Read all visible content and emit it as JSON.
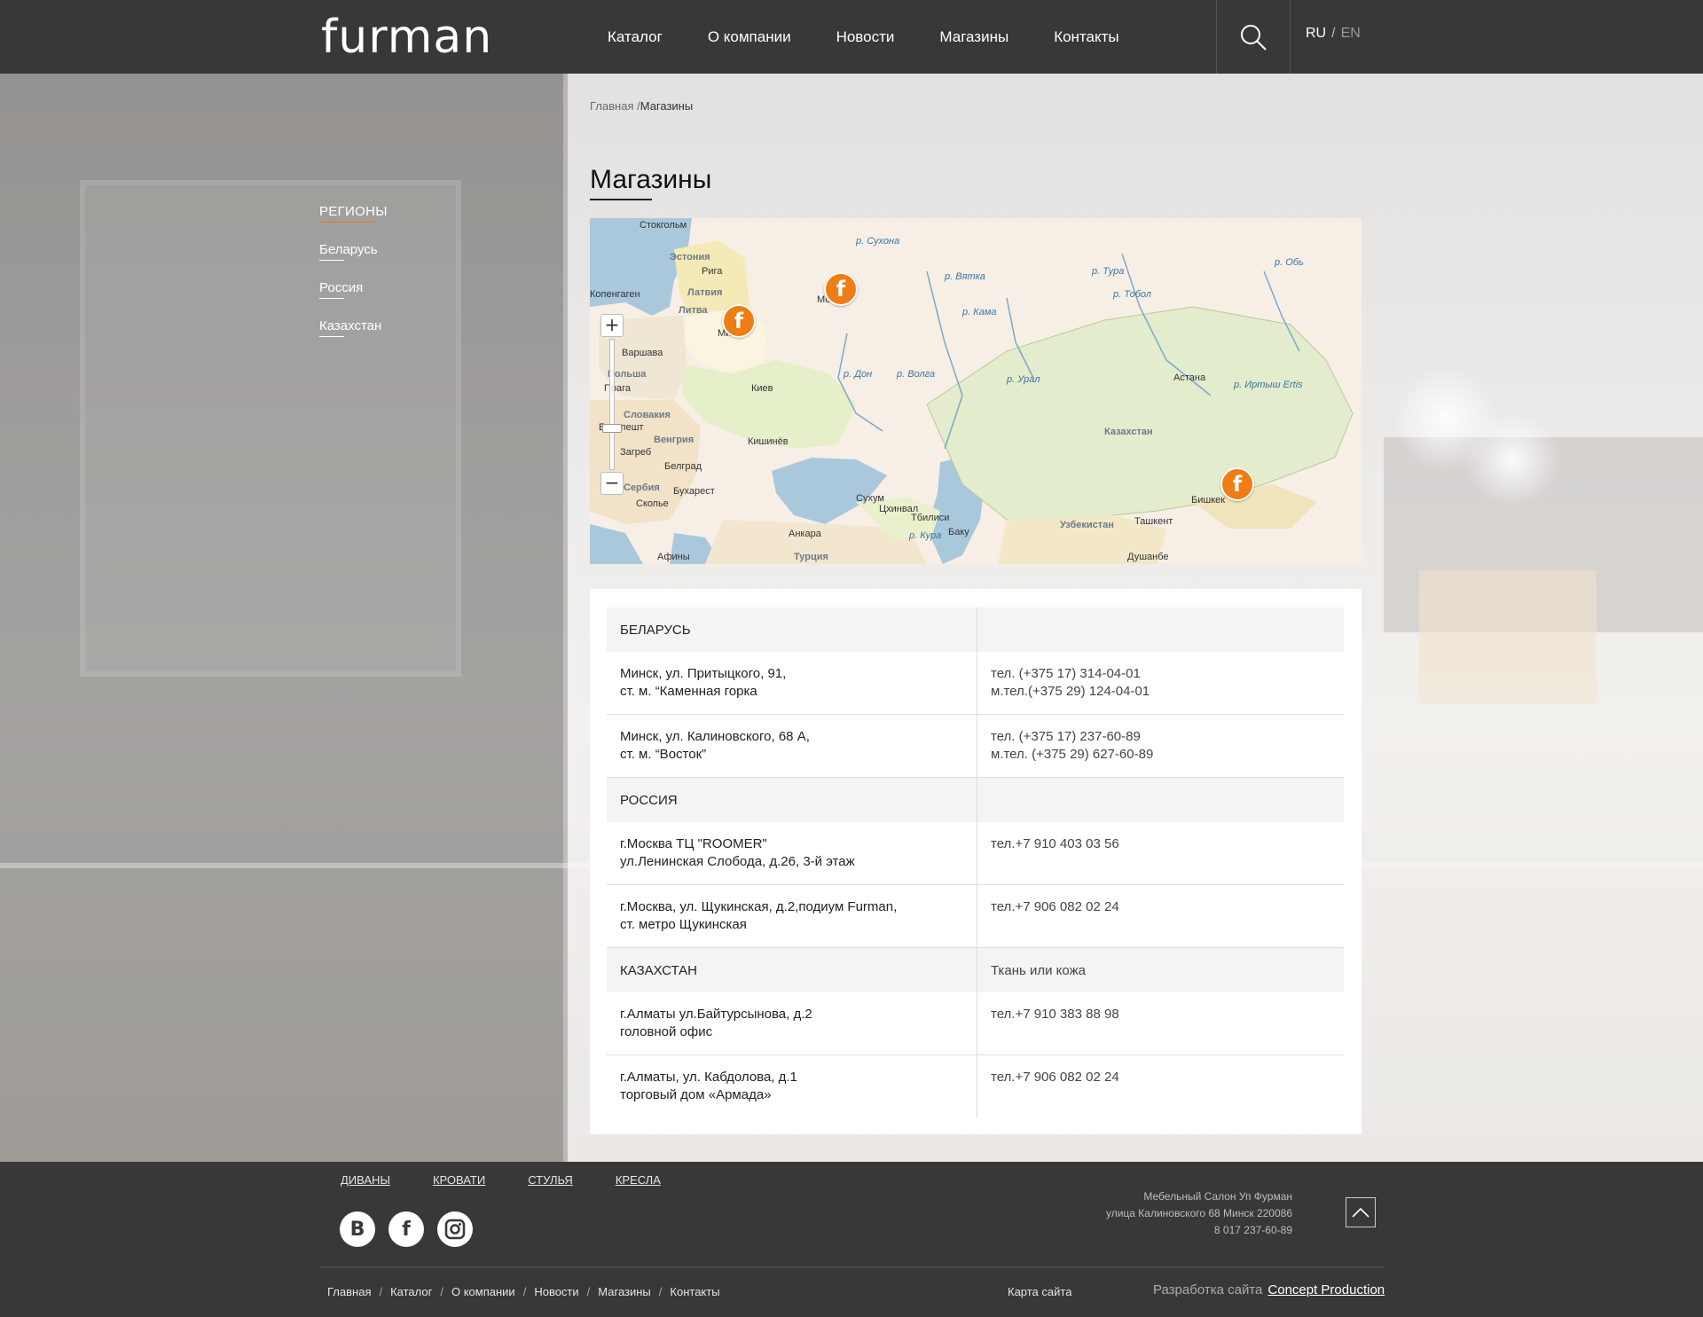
{
  "header": {
    "logo": "furman",
    "nav": [
      "Каталог",
      "О компании",
      "Новости",
      "Магазины",
      "Контакты"
    ],
    "lang_ru": "RU",
    "lang_sep": "/",
    "lang_en": "EN"
  },
  "breadcrumb": {
    "home": "Главная /",
    "current": "Магазины"
  },
  "page_title": "Магазины",
  "sidebar": {
    "heading": "РЕГИОНЫ",
    "items": [
      "Беларусь",
      "Россия",
      "Казахстан"
    ]
  },
  "map": {
    "zoom_in": "+",
    "zoom_out": "−",
    "pin_glyph": "f",
    "labels": {
      "stockholm": "Стокгольм",
      "estonia": "Эстония",
      "riga": "Рига",
      "latvia": "Латвия",
      "copenhagen": "Копенгаген",
      "lithuania": "Литва",
      "minsk": "Минск",
      "moscow": "Москва",
      "warsaw": "Варшава",
      "poland": "Польша",
      "prague": "Прага",
      "kyiv": "Киев",
      "slovakia": "Словакия",
      "budapest": "Будапешт",
      "hungary": "Венгрия",
      "chisinau": "Кишинёв",
      "zagreb": "Загреб",
      "belgrade": "Белград",
      "serbia": "Сербия",
      "bucharest": "Бухарест",
      "skopje": "Скопье",
      "athens": "Афины",
      "ankara": "Анкара",
      "turkey": "Турция",
      "sukhum": "Сухум",
      "tskhinval": "Цхинвал",
      "tbilisi": "Тбилиси",
      "baku": "Баку",
      "kura": "р. Кура",
      "volga": "р. Волга",
      "don": "р. Дон",
      "ural": "р. Урал",
      "kama": "р. Кама",
      "vyatka": "р. Вятка",
      "sukhona": "р. Сухона",
      "tura": "р. Тура",
      "tobol": "р. Тобол",
      "ob": "р. Обь",
      "irtysh": "р. Иртыш Ertis",
      "astana": "Астана",
      "kazakhstan": "Казахстан",
      "uzbekistan": "Узбекистан",
      "tashkent": "Ташкент",
      "bishkek": "Бишкек",
      "dushanbe": "Душанбе"
    }
  },
  "stores": [
    {
      "type": "region",
      "name": "БЕЛАРУСЬ",
      "note": ""
    },
    {
      "type": "store",
      "address": [
        "Минск, ул. Притыцкого, 91,",
        "ст. м. “Каменная горка"
      ],
      "phones": [
        "тел. (+375 17) 314-04-01",
        "м.тел.(+375 29) 124-04-01"
      ]
    },
    {
      "type": "store",
      "address": [
        "Минск, ул. Калиновского, 68 А,",
        "ст. м. “Восток”"
      ],
      "phones": [
        "тел. (+375 17) 237-60-89",
        "м.тел. (+375 29) 627-60-89"
      ]
    },
    {
      "type": "region",
      "name": "РОССИЯ",
      "note": ""
    },
    {
      "type": "store",
      "address": [
        "г.Москва ТЦ \"ROOMER\"",
        "ул.Ленинская Слобода, д.26, 3-й этаж"
      ],
      "phones": [
        "тел.+7 910 403 03 56",
        ""
      ]
    },
    {
      "type": "store",
      "address": [
        "г.Москва, ул. Щукинская, д.2,подиум Furman,",
        "ст. метро Щукинская"
      ],
      "phones": [
        "тел.+7 906 082 02 24",
        ""
      ]
    },
    {
      "type": "region",
      "name": "КАЗАХСТАН",
      "note": "Ткань или кожа"
    },
    {
      "type": "store",
      "address": [
        "г.Алматы ул.Байтурсынова, д.2",
        "головной офис"
      ],
      "phones": [
        "тел.+7 910 383 88 98",
        ""
      ]
    },
    {
      "type": "store",
      "address": [
        "г.Алматы, ул. Кабдолова, д.1",
        "торговый дом «Армада»"
      ],
      "phones": [
        "тел.+7 906 082 02 24",
        ""
      ]
    }
  ],
  "footer": {
    "categories": [
      "ДИВАНЫ",
      "КРОВАТИ",
      "СТУЛЬЯ",
      "КРЕСЛА"
    ],
    "social": {
      "vk": "В",
      "fb": "f"
    },
    "contacts": [
      "Мебельный Салон Уп Фурман",
      "улица Калиновского 68 Минск 220086",
      "8 017 237-60-89"
    ],
    "bottom_links": [
      "Главная",
      "Каталог",
      "О компании",
      "Новости",
      "Магазины",
      "Контакты"
    ],
    "separator": "/",
    "sitemap": "Карта сайта",
    "dev_label": "Разработка сайта",
    "dev_link": "Concept Production"
  }
}
